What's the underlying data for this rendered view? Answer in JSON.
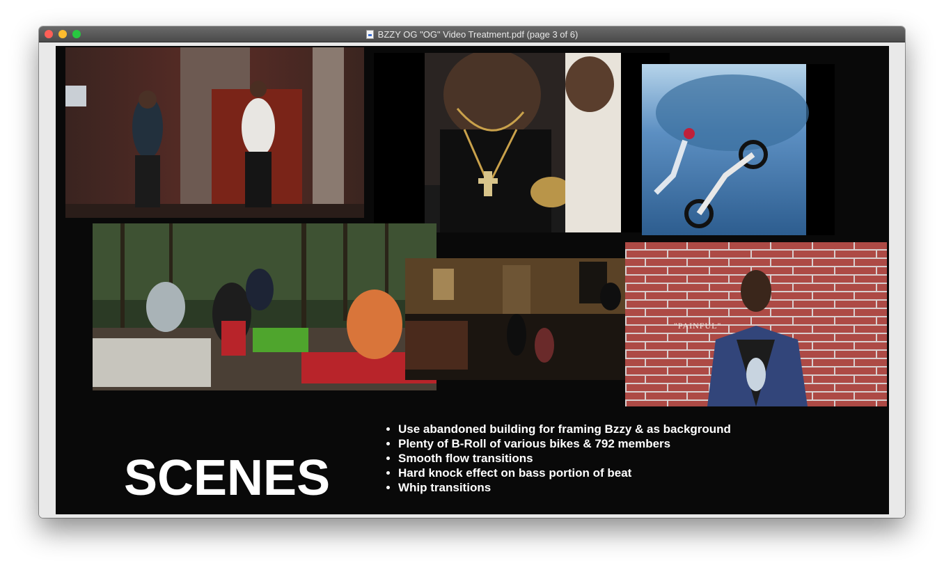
{
  "window": {
    "title": "BZZY OG \"OG\" Video Treatment.pdf (page 3 of 6)",
    "icon": "pdf-document-icon"
  },
  "slide": {
    "heading": "SCENES",
    "bullets": [
      "Use abandoned building for framing Bzzy & as background",
      "Plenty of B-Roll of various bikes & 792 members",
      "Smooth flow transitions",
      "Hard knock effect on bass portion of beat",
      "Whip transitions"
    ],
    "photo_caption": "\"PAINFUL\""
  },
  "colors": {
    "slide_background": "#090909",
    "viewer_background": "#e9e9e9",
    "titlebar": "#4a4a4a"
  }
}
